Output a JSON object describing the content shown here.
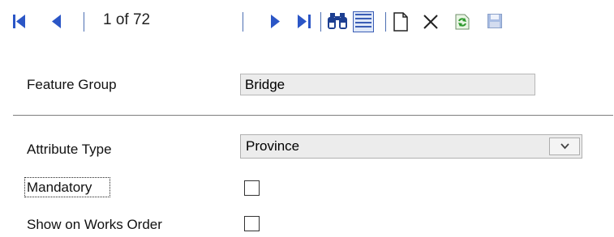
{
  "toolbar": {
    "record_position": "1 of 72",
    "buttons": [
      {
        "name": "first-record-icon"
      },
      {
        "name": "previous-record-icon"
      },
      {
        "name": "next-record-icon"
      },
      {
        "name": "last-record-icon"
      },
      {
        "name": "find-binoculars-icon"
      },
      {
        "name": "list-view-icon"
      },
      {
        "name": "new-record-icon"
      },
      {
        "name": "delete-record-icon"
      },
      {
        "name": "refresh-icon"
      },
      {
        "name": "save-icon"
      }
    ],
    "colors": {
      "nav_blue": "#2b56c6",
      "separator": "#4d6fb3"
    }
  },
  "form": {
    "feature_group": {
      "label": "Feature Group",
      "value": "Bridge"
    },
    "attribute_type": {
      "label": "Attribute Type",
      "value": "Province"
    },
    "mandatory": {
      "label": "Mandatory",
      "checked": false
    },
    "show_on_works_order": {
      "label": "Show on Works Order",
      "checked": false
    }
  }
}
